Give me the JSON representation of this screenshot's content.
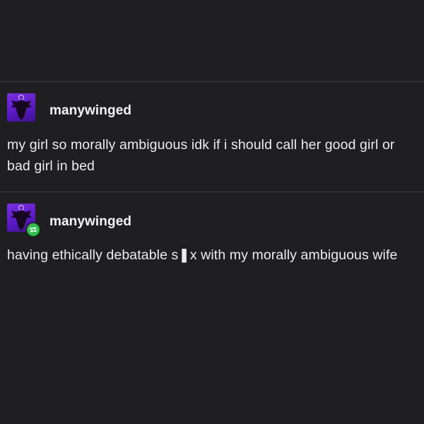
{
  "posts": [
    {
      "username": "manywinged",
      "text": "my girl so morally ambiguous idk if i should call her good girl or bad girl in bed",
      "avatar_icon": "winged-figure-avatar",
      "reblog": false
    },
    {
      "username": "manywinged",
      "text": "having ethically debatable s❚x with my morally ambiguous wife",
      "avatar_icon": "winged-figure-avatar",
      "reblog": true,
      "reblog_icon": "reblog-icon"
    }
  ],
  "colors": {
    "background": "#1f1e20",
    "text": "#ececec",
    "divider": "#3a393b",
    "avatar": "#6a24d6",
    "reblog_badge": "#2fbf4a"
  }
}
